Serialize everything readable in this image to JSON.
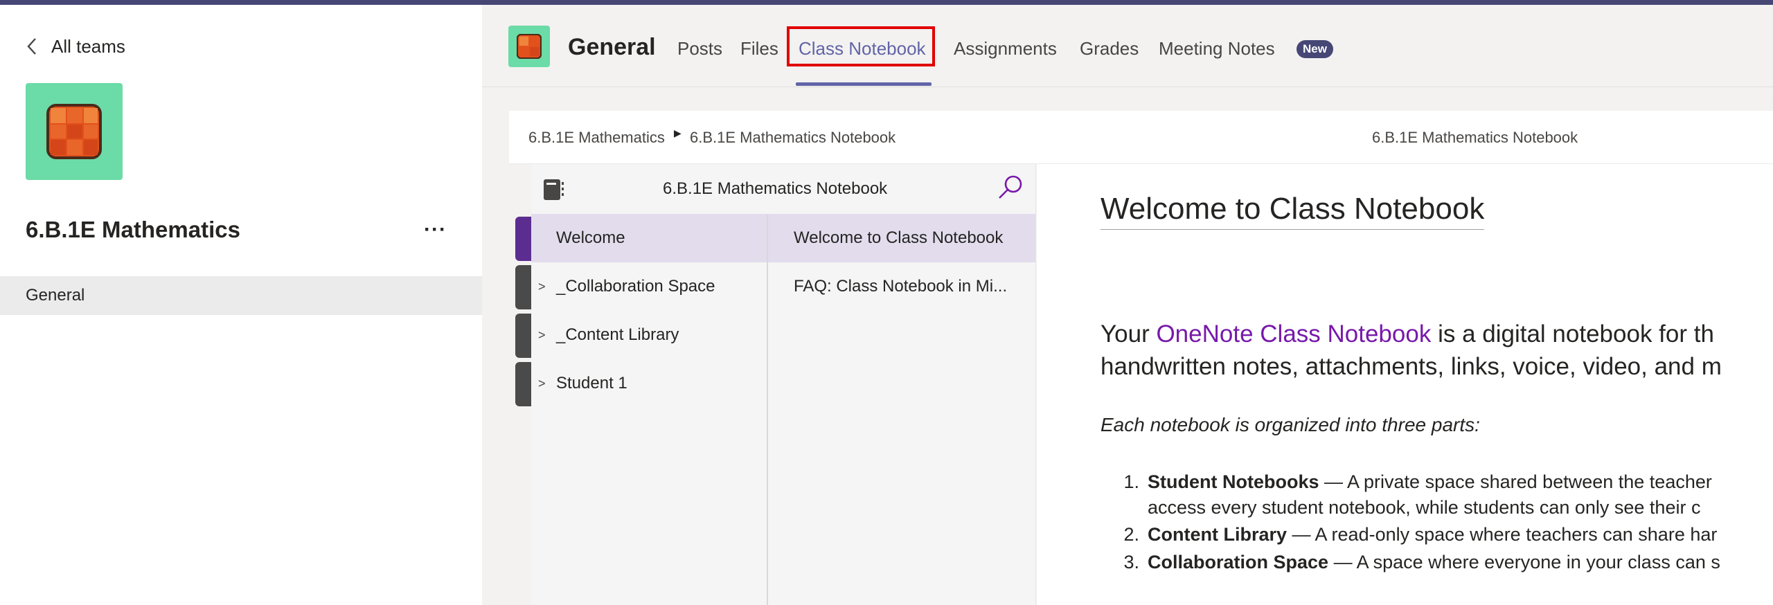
{
  "colors": {
    "accent": "#6264a7",
    "top_strip": "#464775",
    "team_logo_bg": "#6bdba7",
    "highlight_outline": "#e00000",
    "link_purple": "#7719aa",
    "selected_section": "#e2dcec"
  },
  "sidebar": {
    "back_label": "All teams",
    "team_name": "6.B.1E Mathematics",
    "more_label": "···",
    "channels": [
      {
        "label": "General"
      }
    ]
  },
  "header": {
    "channel_title": "General",
    "tabs": [
      {
        "label": "Posts"
      },
      {
        "label": "Files"
      },
      {
        "label": "Class Notebook"
      },
      {
        "label": "Assignments"
      },
      {
        "label": "Grades"
      },
      {
        "label": "Meeting Notes"
      }
    ],
    "new_badge": "New",
    "active_tab": "Class Notebook"
  },
  "breadcrumb": {
    "parent": "6.B.1E Mathematics",
    "current": "6.B.1E Mathematics Notebook",
    "center_title": "6.B.1E Mathematics Notebook"
  },
  "notebook": {
    "title": "6.B.1E Mathematics Notebook",
    "sections": [
      {
        "label": "Welcome",
        "selected": true,
        "expandable": false
      },
      {
        "label": "_Collaboration Space",
        "selected": false,
        "expandable": true
      },
      {
        "label": "_Content Library",
        "selected": false,
        "expandable": true
      },
      {
        "label": "Student 1",
        "selected": false,
        "expandable": true
      }
    ],
    "pages": [
      {
        "label": "Welcome to Class Notebook",
        "selected": true
      },
      {
        "label": "FAQ: Class Notebook in Mi...",
        "selected": false
      }
    ]
  },
  "page": {
    "title": "Welcome to Class Notebook",
    "intro_line1_pre": "Your ",
    "intro_link": "OneNote Class Notebook",
    "intro_line1_post": " is a digital notebook for th",
    "intro_line2": "handwritten notes, attachments, links, voice, video, and m",
    "parts_intro": "Each notebook is organized into three parts:",
    "list": [
      {
        "num": "1.",
        "term": "Student Notebooks",
        "text": " — A private space shared between the teacher",
        "cont": "access every student notebook, while students can only see their c"
      },
      {
        "num": "2.",
        "term": "Content Library",
        "text": " — A read-only space where teachers can share har"
      },
      {
        "num": "3.",
        "term": "Collaboration Space",
        "text": " —  A space where everyone in your class can s"
      }
    ]
  }
}
